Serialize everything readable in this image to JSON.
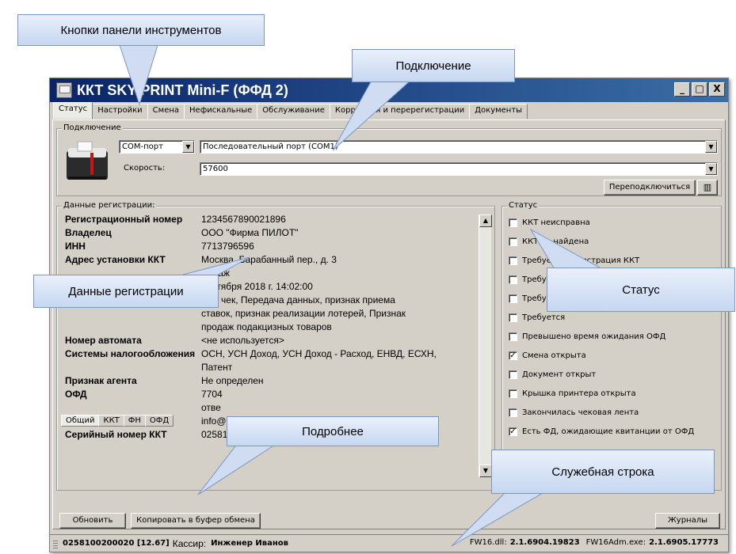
{
  "window": {
    "title": "ККТ SKY-PRINT Mini-F (ФФД 2)",
    "controls": [
      "_",
      "□",
      "X"
    ]
  },
  "tabs": [
    "Статус",
    "Настройки",
    "Смена",
    "Нефискальные",
    "Обслуживание",
    "Коррекция и перерегистрации",
    "Документы"
  ],
  "connection": {
    "legend": "Подключение",
    "port_type": "COM-порт",
    "port": "Последовательный порт (COM1)",
    "speed_label": "Скорость:",
    "speed": "57600",
    "reconnect_label": "Переподключиться"
  },
  "registration": {
    "legend": "Данные регистрации:",
    "rows": [
      {
        "k": "Регистрационный номер",
        "v": "1234567890021896"
      },
      {
        "k": "Владелец",
        "v": "ООО \"Фирма ПИЛОТ\""
      },
      {
        "k": "ИНН",
        "v": "7713796596"
      },
      {
        "k": "Адрес установки ККТ",
        "v": "Москва, Барабанный пер., д. 3"
      },
      {
        "k": "",
        "v": "3 этаж"
      },
      {
        "k": "",
        "v": "сентября 2018 г. 14:02:00"
      },
      {
        "k": "",
        "v": "вый чек, Передача данных, признак приема"
      },
      {
        "k": "",
        "v": "ставок, признак реализации лотерей, Признак"
      },
      {
        "k": "",
        "v": "продаж подакцизных товаров"
      },
      {
        "k": "Номер автомата",
        "v": "<не используется>"
      },
      {
        "k": "Системы налогообложения",
        "v": "ОСН, УСН Доход, УСН Доход - Расход, ЕНВД, ЕСХН,"
      },
      {
        "k": "",
        "v": "Патент"
      },
      {
        "k": "Признак агента",
        "v": "Не определен"
      },
      {
        "k": "ОФД",
        "v": "7704"
      },
      {
        "k": "",
        "v": "отве"
      },
      {
        "k": "Адрес отправителя",
        "v": "info@"
      },
      {
        "k": "",
        "v": ""
      },
      {
        "k": "Серийный номер ККТ",
        "v": "0258100020"
      }
    ],
    "subtabs": [
      "Общий",
      "ККТ",
      "ФН",
      "ОФД"
    ]
  },
  "status": {
    "legend": "Статус",
    "items": [
      {
        "label": "ККТ неисправна",
        "checked": false
      },
      {
        "label": "ККТ не найдена",
        "checked": false
      },
      {
        "label": "Требуется регистрация ККТ",
        "checked": false
      },
      {
        "label": "Требуется",
        "checked": false
      },
      {
        "label": "Требуется",
        "checked": false
      },
      {
        "label": "Требуется",
        "checked": false
      },
      {
        "label": "Превышено время ожидания ОФД",
        "checked": false
      },
      {
        "label": "Смена открыта",
        "checked": true
      },
      {
        "label": "Документ открыт",
        "checked": false
      },
      {
        "label": "Крышка принтера открыта",
        "checked": false
      },
      {
        "label": "Закончилась чековая лента",
        "checked": false
      },
      {
        "label": "Есть ФД, ожидающие квитанции от ОФД",
        "checked": true
      }
    ]
  },
  "buttons": {
    "refresh": "Обновить",
    "copy": "Копировать в буфер обмена",
    "journals": "Журналы"
  },
  "statusbar": {
    "device": "0258100200020 [12.67]",
    "cashier_label": "Кассир:",
    "cashier": "Инженер Иванов",
    "fw16_label": "FW16.dll:",
    "fw16": "2.1.6904.19823",
    "fw16adm_label": "FW16Adm.exe:",
    "fw16adm": "2.1.6905.17773"
  },
  "callouts": {
    "toolbar": "Кнопки панели инструментов",
    "connection": "Подключение",
    "registration": "Данные регистрации",
    "status": "Статус",
    "details": "Подробнее",
    "service_line": "Служебная строка"
  }
}
